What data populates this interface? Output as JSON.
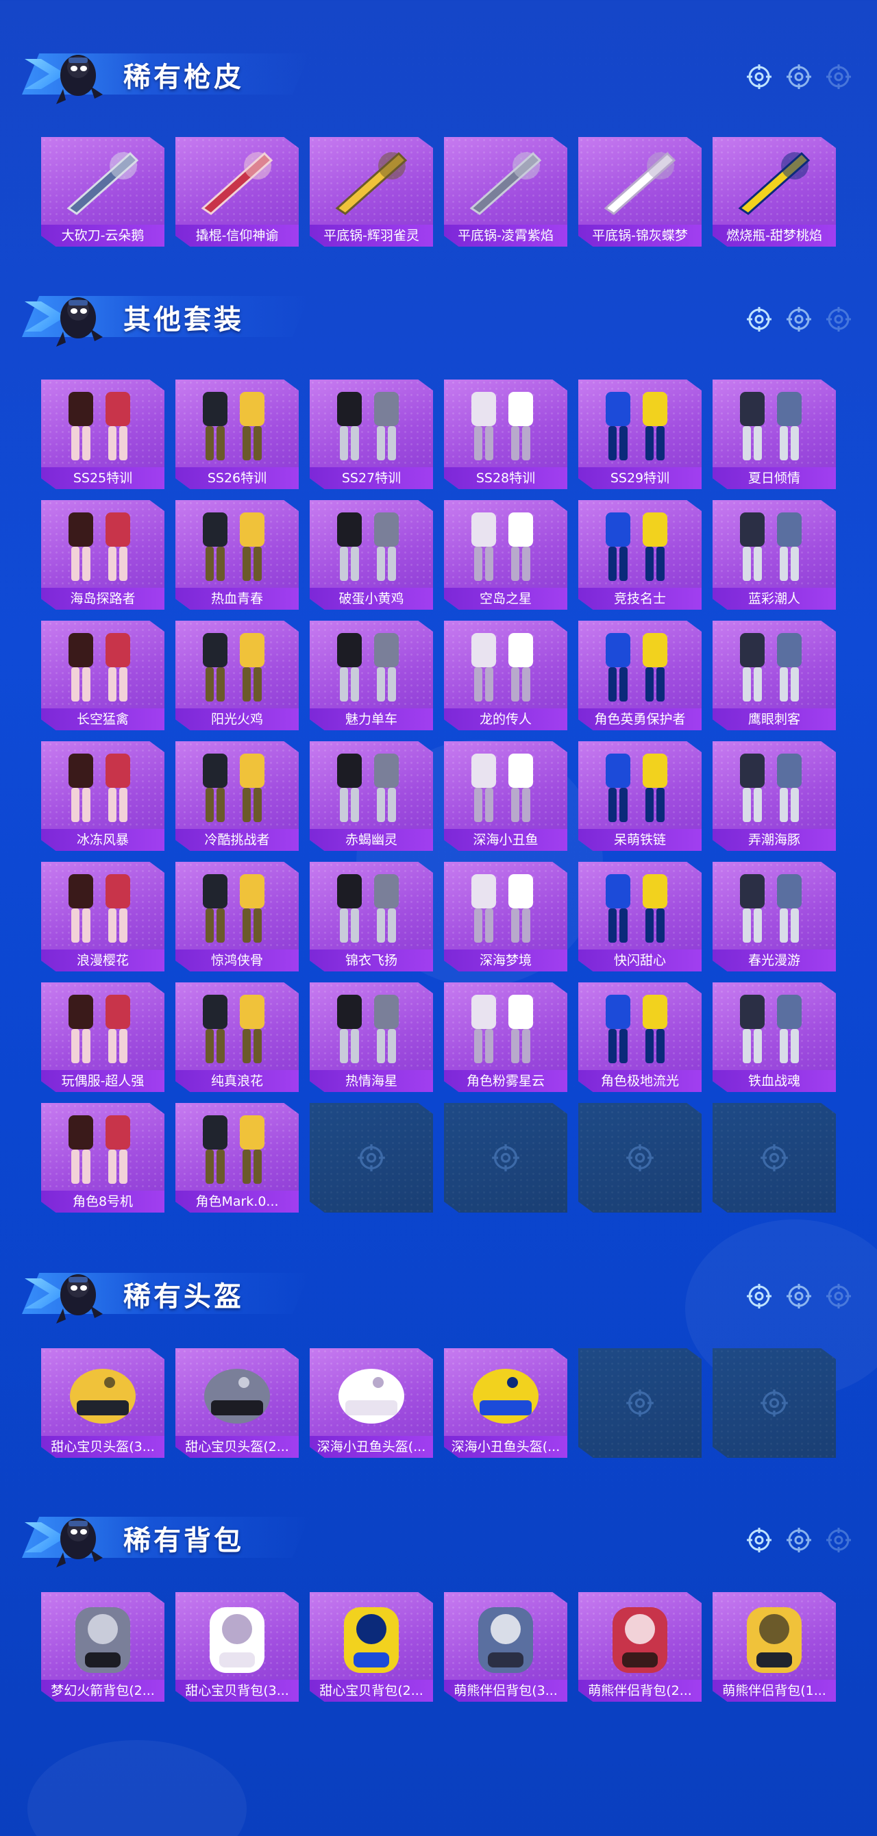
{
  "colors": {
    "background": "#0f4ad6",
    "card_purple": "#a24fe0",
    "label_purple": "#7d28d8",
    "empty_slot": "#1c4580"
  },
  "sections": [
    {
      "title": "稀有枪皮",
      "items": [
        "大砍刀-云朵鹅",
        "撬棍-信仰神谕",
        "平底锅-辉羽雀灵",
        "平底锅-凌霄紫焰",
        "平底锅-锦灰蝶梦",
        "燃烧瓶-甜梦桃焰"
      ],
      "empty_slots": 0
    },
    {
      "title": "其他套装",
      "items": [
        "SS25特训",
        "SS26特训",
        "SS27特训",
        "SS28特训",
        "SS29特训",
        "夏日倾情",
        "海岛探路者",
        "热血青春",
        "破蛋小黄鸡",
        "空岛之星",
        "竞技名士",
        "蓝彩潮人",
        "长空猛禽",
        "阳光火鸡",
        "魅力单车",
        "龙的传人",
        "角色英勇保护者",
        "鹰眼刺客",
        "冰冻风暴",
        "冷酷挑战者",
        "赤蝎幽灵",
        "深海小丑鱼",
        "呆萌铁链",
        "弄潮海豚",
        "浪漫樱花",
        "惊鸿侠骨",
        "锦衣飞扬",
        "深海梦境",
        "快闪甜心",
        "春光漫游",
        "玩偶服-超人强",
        "纯真浪花",
        "热情海星",
        "角色粉雾星云",
        "角色极地流光",
        "铁血战魂",
        "角色8号机",
        "角色Mark.0..."
      ],
      "empty_slots": 4
    },
    {
      "title": "稀有头盔",
      "items": [
        "甜心宝贝头盔(3...",
        "甜心宝贝头盔(2...",
        "深海小丑鱼头盔(...",
        "深海小丑鱼头盔(..."
      ],
      "empty_slots": 2
    },
    {
      "title": "稀有背包",
      "items": [
        "梦幻火箭背包(2...",
        "甜心宝贝背包(3...",
        "甜心宝贝背包(2...",
        "萌熊伴侣背包(3...",
        "萌熊伴侣背包(2...",
        "萌熊伴侣背包(1..."
      ],
      "empty_slots": 0
    }
  ]
}
